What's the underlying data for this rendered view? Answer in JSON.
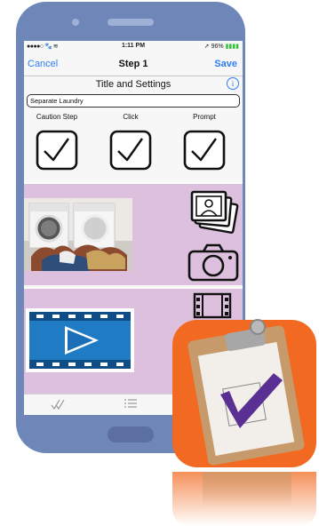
{
  "status_bar": {
    "carrier": "●●●●○",
    "time": "1:11 PM",
    "battery": "96%",
    "battery_bars": "▮▮▮▮"
  },
  "nav": {
    "cancel_label": "Cancel",
    "title": "Step 1",
    "save_label": "Save"
  },
  "settings": {
    "header": "Title and Settings",
    "info_glyph": "i",
    "step_name": "Separate Laundry",
    "options": [
      {
        "label": "Caution Step",
        "checked": true
      },
      {
        "label": "Click",
        "checked": true
      },
      {
        "label": "Prompt",
        "checked": true
      }
    ]
  },
  "colors": {
    "accent": "#2f7cf6",
    "phone_body": "#6f86b8",
    "section_bg": "#dcc0dd",
    "app_icon_orange": "#f26a21",
    "checkmark_purple": "#5a2f94"
  },
  "icons": {
    "photos": "photo-library-icon",
    "camera": "camera-icon",
    "film": "film-strip-icon",
    "play": "play-icon",
    "tab_steps": "checkmarks-icon",
    "tab_list": "list-icon"
  }
}
